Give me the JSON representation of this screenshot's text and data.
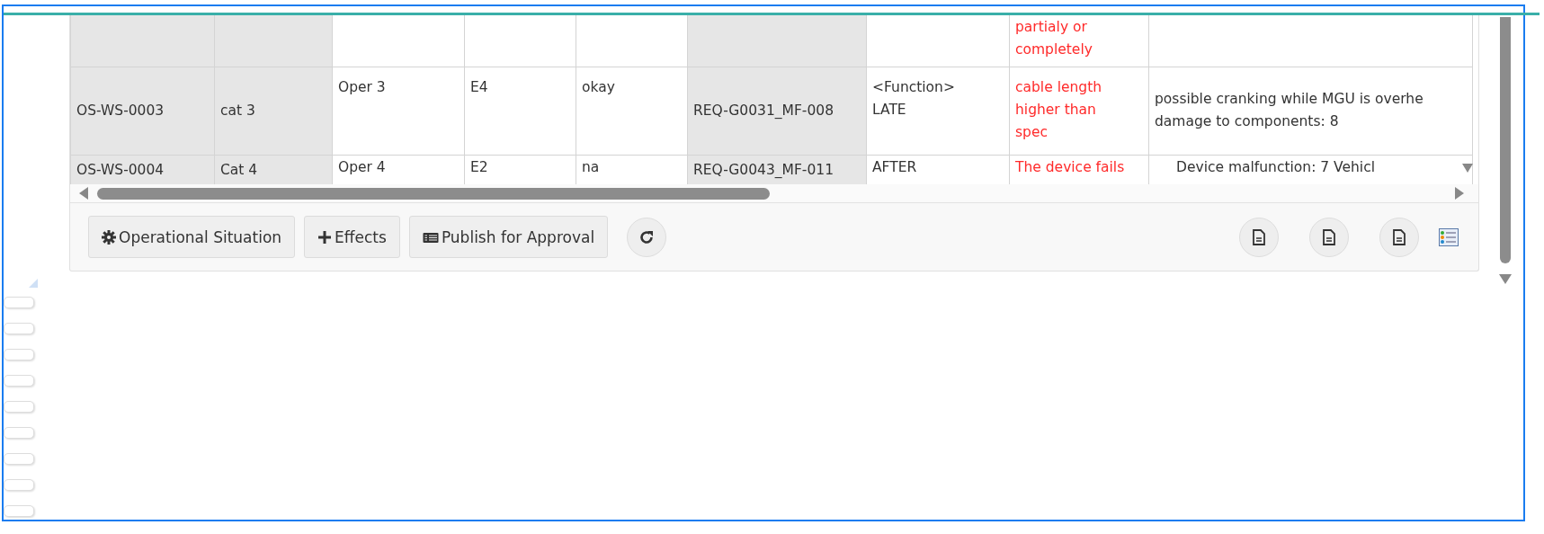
{
  "table": {
    "columns": [
      {
        "shaded": true
      },
      {
        "shaded": true
      },
      {
        "shaded": false
      },
      {
        "shaded": false
      },
      {
        "shaded": false
      },
      {
        "shaded": true
      },
      {
        "shaded": false
      },
      {
        "shaded": false
      },
      {
        "shaded": false
      }
    ],
    "rows": [
      {
        "cells": [
          {},
          {},
          {},
          {},
          {},
          {},
          {},
          {
            "lines": [
              "partialy or",
              "completely"
            ],
            "alert": true
          },
          {}
        ]
      },
      {
        "cells": [
          {
            "lines": [
              "OS-WS-0003"
            ],
            "alert": false
          },
          {
            "lines": [
              "cat 3"
            ],
            "alert": false
          },
          {
            "lines": [
              "Oper 3"
            ],
            "alert": false
          },
          {
            "lines": [
              "E4"
            ],
            "alert": false
          },
          {
            "lines": [
              "okay"
            ],
            "alert": false
          },
          {
            "lines": [
              "REQ-G0031_MF-008"
            ],
            "alert": false
          },
          {
            "lines": [
              "<Function>",
              "LATE"
            ],
            "alert": false
          },
          {
            "lines": [
              "cable length",
              "higher than",
              "spec"
            ],
            "alert": true
          },
          {
            "lines": [
              "possible cranking while MGU is overhe",
              "damage to components: 8"
            ],
            "alert": false
          }
        ]
      },
      {
        "cells": [
          {
            "lines": [
              "OS-WS-0004"
            ],
            "alert": false
          },
          {
            "lines": [
              "Cat 4"
            ],
            "alert": false
          },
          {
            "lines": [
              "Oper 4"
            ],
            "alert": false
          },
          {
            "lines": [
              "E2"
            ],
            "alert": false
          },
          {
            "lines": [
              "na"
            ],
            "alert": false
          },
          {
            "lines": [
              "REQ-G0043_MF-011"
            ],
            "alert": false
          },
          {
            "lines": [
              "AFTER"
            ],
            "alert": false
          },
          {
            "lines": [
              "The device fails"
            ],
            "alert": true
          },
          {
            "lines": [
              "Device malfunction: 7 Vehicl"
            ],
            "alert": false
          }
        ]
      }
    ]
  },
  "toolbar": {
    "buttons": [
      {
        "kind": "gear",
        "label": "Operational Situation"
      },
      {
        "kind": "plus",
        "label": "Effects"
      },
      {
        "kind": "list",
        "label": "Publish for Approval"
      }
    ]
  }
}
